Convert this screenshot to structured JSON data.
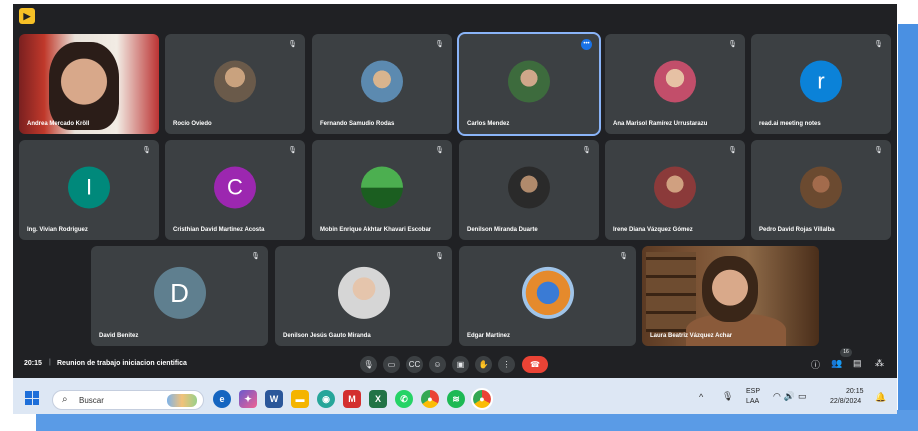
{
  "participants": [
    {
      "name": "Andrea Mercado Kröll",
      "kind": "video"
    },
    {
      "name": "Rocío Oviedo",
      "kind": "avatar"
    },
    {
      "name": "Fernando Samudio Rodas",
      "kind": "avatar"
    },
    {
      "name": "Carlos Mendez",
      "kind": "avatar",
      "speaking": true
    },
    {
      "name": "Ana Marisol Ramírez Urrustarazu",
      "kind": "avatar"
    },
    {
      "name": "read.ai meeting notes",
      "kind": "initial",
      "initial": "r",
      "color": "#0b82d8"
    },
    {
      "name": "Ing. Vivian Rodriguez",
      "kind": "initial",
      "initial": "I",
      "color": "#00897b"
    },
    {
      "name": "Cristhian David Martinez Acosta",
      "kind": "initial",
      "initial": "C",
      "color": "#9c27b0"
    },
    {
      "name": "Mobin Enrique Akhtar Khavari Escobar",
      "kind": "avatar"
    },
    {
      "name": "Denilson Miranda Duarte",
      "kind": "avatar"
    },
    {
      "name": "Irene Diana Vázquez Gómez",
      "kind": "avatar"
    },
    {
      "name": "Pedro David Rojas Villalba",
      "kind": "avatar"
    },
    {
      "name": "David Benitez",
      "kind": "initial",
      "initial": "D",
      "color": "#5f7f8f"
    },
    {
      "name": "Denilson Jesús Gauto Miranda",
      "kind": "avatar"
    },
    {
      "name": "Edgar Martinez",
      "kind": "avatar"
    },
    {
      "name": "Laura Beatriz Vázquez Achar",
      "kind": "video"
    }
  ],
  "meeting": {
    "time": "20:15",
    "separator": "|",
    "title": "Reunion de trabajo iniciacion cientifica",
    "people_count": "16"
  },
  "controls": [
    "mic-icon",
    "camera-icon",
    "captions-icon",
    "emoji-icon",
    "present-icon",
    "raise-hand-icon",
    "more-icon",
    "end-call-icon"
  ],
  "right_controls": [
    "info-icon",
    "people-icon",
    "chat-icon",
    "activities-icon"
  ],
  "taskbar": {
    "search_placeholder": "Buscar",
    "apps": [
      "edge",
      "copilot",
      "word",
      "file-explorer",
      "chrome-canary",
      "app-red",
      "excel",
      "whatsapp",
      "chrome",
      "spotify",
      "chrome-active"
    ],
    "lang_top": "ESP",
    "lang_bottom": "LAA",
    "clock_time": "20:15",
    "clock_date": "22/8/2024"
  },
  "colors": {
    "meet_bg": "#202124",
    "tile_bg": "#3c4043",
    "active_outline": "#8ab4f8",
    "end_call": "#ea4335",
    "taskbar": "#dde7f4"
  }
}
